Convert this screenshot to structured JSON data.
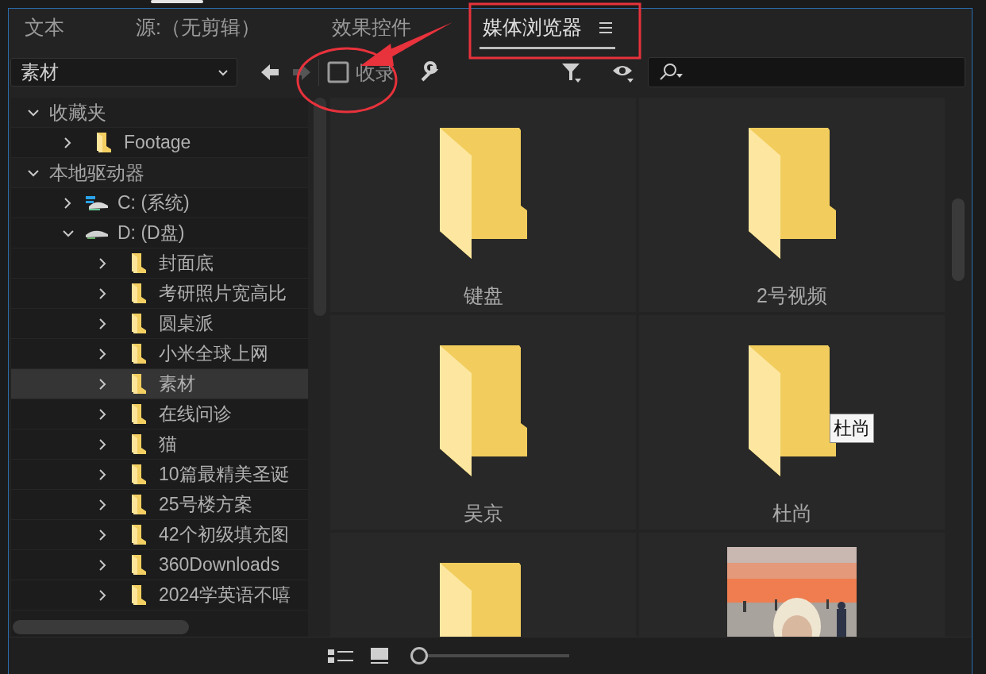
{
  "tabs": [
    {
      "label": "文本",
      "selected": false
    },
    {
      "label": "源:（无剪辑）",
      "selected": false
    },
    {
      "label": "效果控件",
      "selected": false
    },
    {
      "label": "媒体浏览器",
      "selected": true
    }
  ],
  "toolbar": {
    "location": "素材",
    "back": {
      "disabled": false
    },
    "forward": {
      "disabled": true
    },
    "ingest": {
      "label": "收录",
      "checked": false
    }
  },
  "tree": [
    {
      "label": "收藏夹",
      "kind": "group",
      "expanded": true,
      "selected": false,
      "children": [
        {
          "label": "Footage",
          "kind": "folder",
          "expanded": false,
          "selected": false
        }
      ]
    },
    {
      "label": "本地驱动器",
      "kind": "group",
      "expanded": true,
      "selected": false,
      "children": [
        {
          "label": "C: (系统)",
          "kind": "system-drive",
          "expanded": false,
          "selected": false
        },
        {
          "label": "D: (D盘)",
          "kind": "drive",
          "expanded": true,
          "selected": false,
          "children": [
            {
              "label": "封面底",
              "kind": "folder",
              "expanded": false,
              "selected": false
            },
            {
              "label": "考研照片宽高比",
              "kind": "folder",
              "expanded": false,
              "selected": false
            },
            {
              "label": "圆桌派",
              "kind": "folder",
              "expanded": false,
              "selected": false
            },
            {
              "label": "小米全球上网",
              "kind": "folder",
              "expanded": false,
              "selected": false
            },
            {
              "label": "素材",
              "kind": "folder",
              "expanded": false,
              "selected": true
            },
            {
              "label": "在线问诊",
              "kind": "folder",
              "expanded": false,
              "selected": false
            },
            {
              "label": "猫",
              "kind": "folder",
              "expanded": false,
              "selected": false
            },
            {
              "label": "10篇最精美圣诞",
              "kind": "folder",
              "expanded": false,
              "selected": false
            },
            {
              "label": "25号楼方案",
              "kind": "folder",
              "expanded": false,
              "selected": false
            },
            {
              "label": "42个初级填充图",
              "kind": "folder",
              "expanded": false,
              "selected": false
            },
            {
              "label": "360Downloads",
              "kind": "folder",
              "expanded": false,
              "selected": false
            },
            {
              "label": "2024学英语不嘻",
              "kind": "folder",
              "expanded": false,
              "selected": false
            }
          ]
        }
      ]
    }
  ],
  "grid": {
    "items": [
      {
        "kind": "folder",
        "name": "键盘"
      },
      {
        "kind": "folder",
        "name": "2号视频"
      },
      {
        "kind": "folder",
        "name": "吴京"
      },
      {
        "kind": "folder",
        "name": "杜尚",
        "tooltip": "杜尚"
      },
      {
        "kind": "folder"
      },
      {
        "kind": "picture"
      }
    ]
  },
  "zoom_slider": {
    "level": 0
  }
}
